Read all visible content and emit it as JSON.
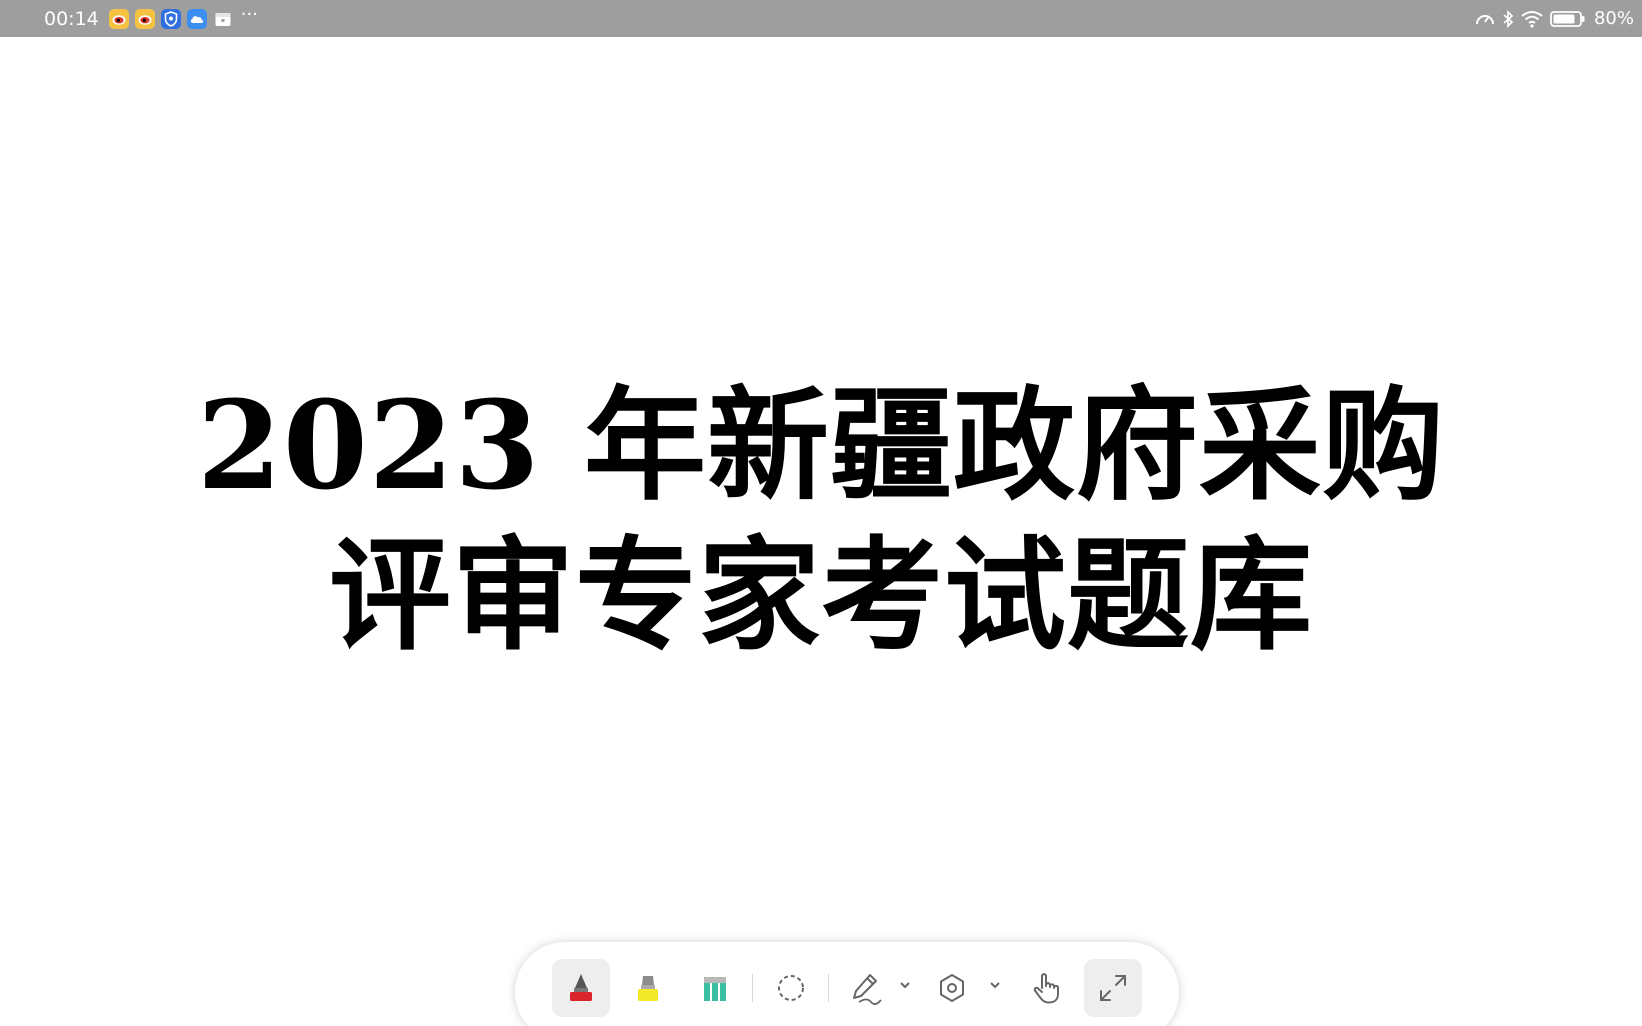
{
  "status_bar": {
    "time": "00:14",
    "more_label": "···",
    "battery_percent": "80%",
    "colors": {
      "background": "#9e9e9e",
      "weibo_icon": "#f5c242",
      "shield_icon": "#2f6fe0",
      "cloud_icon": "#3b8ff0"
    },
    "notification_icons": [
      "weibo-icon",
      "weibo-icon",
      "shield-icon",
      "cloud-icon",
      "calendar-icon"
    ],
    "system_icons": [
      "data-speed-icon",
      "bluetooth-icon",
      "wifi-icon",
      "battery-icon"
    ]
  },
  "document": {
    "title_line_1": "2023 年新疆政府采购",
    "title_line_2": "评审专家考试题库"
  },
  "toolbar": {
    "tools": [
      {
        "name": "pen-tool",
        "icon": "marker-red-icon",
        "active": true,
        "color": "#d9252b"
      },
      {
        "name": "highlighter-tool",
        "icon": "highlighter-yellow-icon",
        "active": false,
        "color": "#f2e92a"
      },
      {
        "name": "eraser-tool",
        "icon": "eraser-teal-icon",
        "active": false,
        "color": "#3dbfa6"
      },
      {
        "name": "lasso-tool",
        "icon": "lasso-icon",
        "active": false
      },
      {
        "name": "handwriting-tool",
        "icon": "pen-scribble-icon",
        "active": false
      },
      {
        "name": "shape-tool",
        "icon": "hexagon-icon",
        "active": false
      },
      {
        "name": "hand-tool",
        "icon": "hand-pointer-icon",
        "active": false
      },
      {
        "name": "fullscreen-tool",
        "icon": "expand-icon",
        "active": true
      }
    ]
  }
}
